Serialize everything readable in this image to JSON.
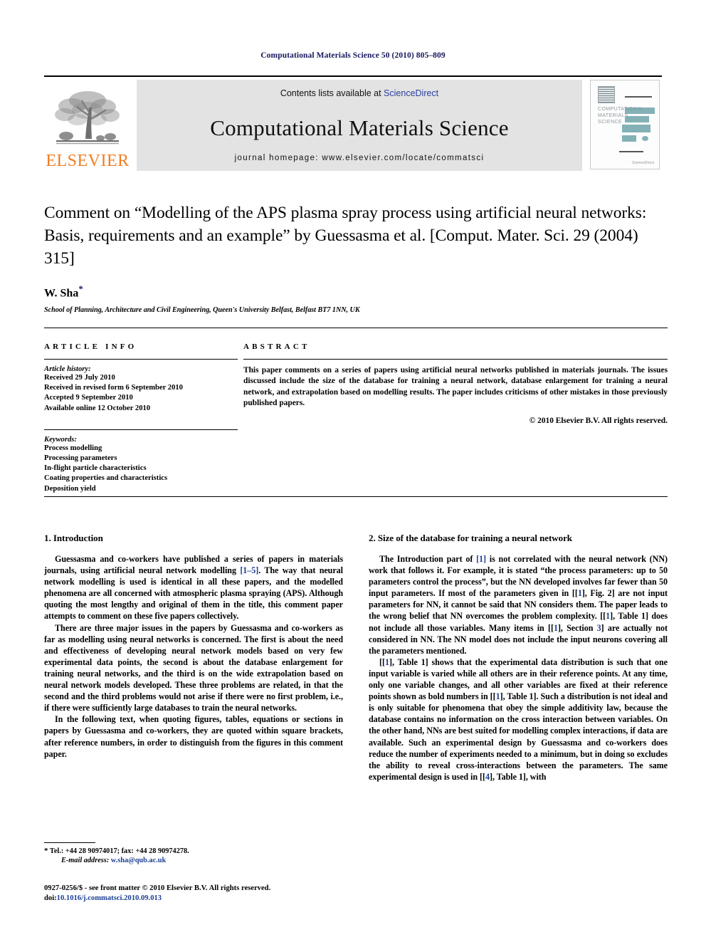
{
  "running_head": "Computational Materials Science 50 (2010) 805–809",
  "masthead": {
    "publisher_wordmark": "ELSEVIER",
    "contents_prefix": "Contents lists available at ",
    "contents_link": "ScienceDirect",
    "journal_name": "Computational Materials Science",
    "homepage_line": "journal homepage: www.elsevier.com/locate/commatsci",
    "cover": {
      "line1": "COMPUTATIONAL",
      "line2": "MATERIALS",
      "line3": "SCIENCE",
      "foot": "ScienceDirect"
    }
  },
  "article": {
    "title": "Comment on “Modelling of the APS plasma spray process using artificial neural networks: Basis, requirements and an example” by Guessasma et al. [Comput. Mater. Sci. 29 (2004) 315]",
    "author": "W. Sha",
    "author_marker": "*",
    "affiliation": "School of Planning, Architecture and Civil Engineering, Queen's University Belfast, Belfast BT7 1NN, UK"
  },
  "article_info": {
    "heading": "ARTICLE INFO",
    "history_label": "Article history:",
    "history": [
      "Received 29 July 2010",
      "Received in revised form 6 September 2010",
      "Accepted 9 September 2010",
      "Available online 12 October 2010"
    ],
    "keywords_label": "Keywords:",
    "keywords": [
      "Process modelling",
      "Processing parameters",
      "In-flight particle characteristics",
      "Coating properties and characteristics",
      "Deposition yield"
    ]
  },
  "abstract": {
    "heading": "ABSTRACT",
    "text": "This paper comments on a series of papers using artificial neural networks published in materials journals. The issues discussed include the size of the database for training a neural network, database enlargement for training a neural network, and extrapolation based on modelling results. The paper includes criticisms of other mistakes in those previously published papers.",
    "copyright": "© 2010 Elsevier B.V. All rights reserved."
  },
  "sections": {
    "left": {
      "heading": "1. Introduction",
      "paragraphs": [
        {
          "parts": [
            {
              "t": "Guessasma and co-workers have published a series of papers in materials journals, using artificial neural network modelling "
            },
            {
              "t": "[1–5]",
              "ref": true
            },
            {
              "t": ". The way that neural network modelling is used is identical in all these papers, and the modelled phenomena are all concerned with atmospheric plasma spraying (APS). Although quoting the most lengthy and original of them in the title, this comment paper attempts to comment on these five papers collectively."
            }
          ]
        },
        {
          "parts": [
            {
              "t": "There are three major issues in the papers by Guessasma and co-workers as far as modelling using neural networks is concerned. The first is about the need and effectiveness of developing neural network models based on very few experimental data points, the second is about the database enlargement for training neural networks, and the third is on the wide extrapolation based on neural network models developed. These three problems are related, in that the second and the third problems would not arise if there were no first problem, i.e., if there were sufficiently large databases to train the neural networks."
            }
          ]
        },
        {
          "parts": [
            {
              "t": "In the following text, when quoting figures, tables, equations or sections in papers by Guessasma and co-workers, they are quoted within square brackets, after reference numbers, in order to distinguish from the figures in this comment paper."
            }
          ]
        }
      ]
    },
    "right": {
      "heading": "2. Size of the database for training a neural network",
      "paragraphs": [
        {
          "parts": [
            {
              "t": "The Introduction part of "
            },
            {
              "t": "[1]",
              "ref": true
            },
            {
              "t": " is not correlated with the neural network (NN) work that follows it. For example, it is stated “the process parameters: up to 50 parameters control the process”, but the NN developed involves far fewer than 50 input parameters. If most of the parameters given in [["
            },
            {
              "t": "1",
              "ref": true
            },
            {
              "t": "], Fig. 2] are not input parameters for NN, it cannot be said that NN considers them. The paper leads to the wrong belief that NN overcomes the problem complexity. [["
            },
            {
              "t": "1",
              "ref": true
            },
            {
              "t": "], Table 1] does not include all those variables. Many items in [["
            },
            {
              "t": "1",
              "ref": true
            },
            {
              "t": "], Section "
            },
            {
              "t": "3",
              "ref": true
            },
            {
              "t": "] are actually not considered in NN. The NN model does not include the input neurons covering all the parameters mentioned."
            }
          ]
        },
        {
          "parts": [
            {
              "t": "[["
            },
            {
              "t": "1",
              "ref": true
            },
            {
              "t": "], Table 1] shows that the experimental data distribution is such that one input variable is varied while all others are in their reference points. At any time, only one variable changes, and all other variables are fixed at their reference points shown as bold numbers in [["
            },
            {
              "t": "1",
              "ref": true
            },
            {
              "t": "], Table 1]. Such a distribution is not ideal and is only suitable for phenomena that obey the simple additivity law, because the database contains no information on the cross interaction between variables. On the other hand, NNs are best suited for modelling complex interactions, if data are available. Such an experimental design by Guessasma and co-workers does reduce the number of experiments needed to a minimum, but in doing so excludes the ability to reveal cross-interactions between the parameters. The same experimental design is used in [["
            },
            {
              "t": "4",
              "ref": true
            },
            {
              "t": "], Table 1], with"
            }
          ]
        }
      ]
    }
  },
  "footnotes": {
    "tel_marker": "*",
    "tel": "Tel.: +44 28 90974017; fax: +44 28 90974278.",
    "email_label": "E-mail address:",
    "email": "w.sha@qub.ac.uk"
  },
  "footer": {
    "issn_line": "0927-0256/$ - see front matter © 2010 Elsevier B.V. All rights reserved.",
    "doi_label": "doi:",
    "doi": "10.1016/j.commatsci.2010.09.013"
  }
}
